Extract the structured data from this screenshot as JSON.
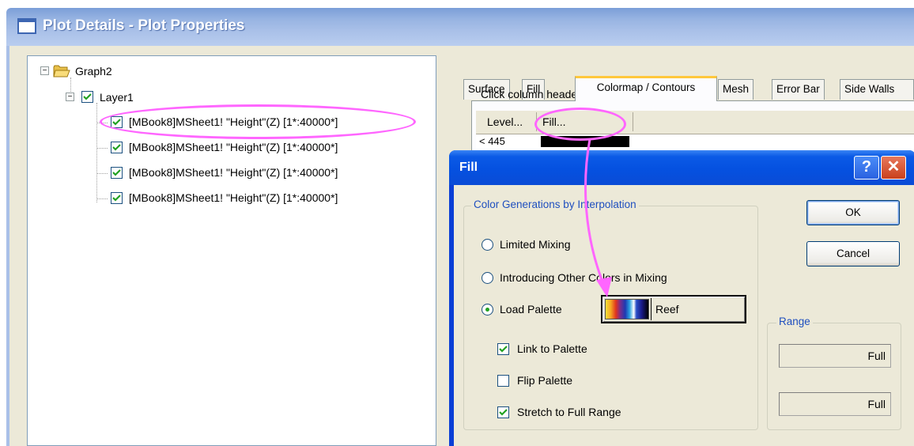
{
  "window": {
    "title": "Plot Details - Plot Properties"
  },
  "tree": {
    "root_label": "Graph2",
    "layer_label": "Layer1",
    "plots": [
      "[MBook8]MSheet1! \"Height\"(Z) [1*:40000*]",
      "[MBook8]MSheet1! \"Height\"(Z) [1*:40000*]",
      "[MBook8]MSheet1! \"Height\"(Z) [1*:40000*]",
      "[MBook8]MSheet1! \"Height\"(Z) [1*:40000*]"
    ]
  },
  "tabs": {
    "surface": "Surface",
    "fill": "Fill",
    "colormap": "Colormap / Contours",
    "mesh": "Mesh",
    "error_bar": "Error Bar",
    "side_walls": "Side Walls",
    "active": "colormap"
  },
  "colormap": {
    "hint": "Click column header or cell to edit",
    "col_level": "Level...",
    "col_fill": "Fill...",
    "first_level": "< 445"
  },
  "fill_dialog": {
    "title": "Fill",
    "help_glyph": "?",
    "close_glyph": "✕",
    "group_label": "Color Generations by Interpolation",
    "option_limited": "Limited Mixing",
    "option_other": "Introducing Other Colors in Mixing",
    "option_palette": "Load Palette",
    "selected_option": "Load Palette",
    "palette_name": "Reef",
    "link_to_palette": "Link to Palette",
    "link_to_palette_checked": true,
    "flip_palette": "Flip Palette",
    "flip_palette_checked": false,
    "stretch": "Stretch to Full Range",
    "stretch_checked": true,
    "ok_label": "OK",
    "cancel_label": "Cancel",
    "range_label": "Range",
    "range_from": "Full",
    "range_to": "Full"
  },
  "colors": {
    "annotation": "#ff66ff",
    "titlebar_blue": "#0551e0",
    "group_legend": "#1f4fbf"
  }
}
